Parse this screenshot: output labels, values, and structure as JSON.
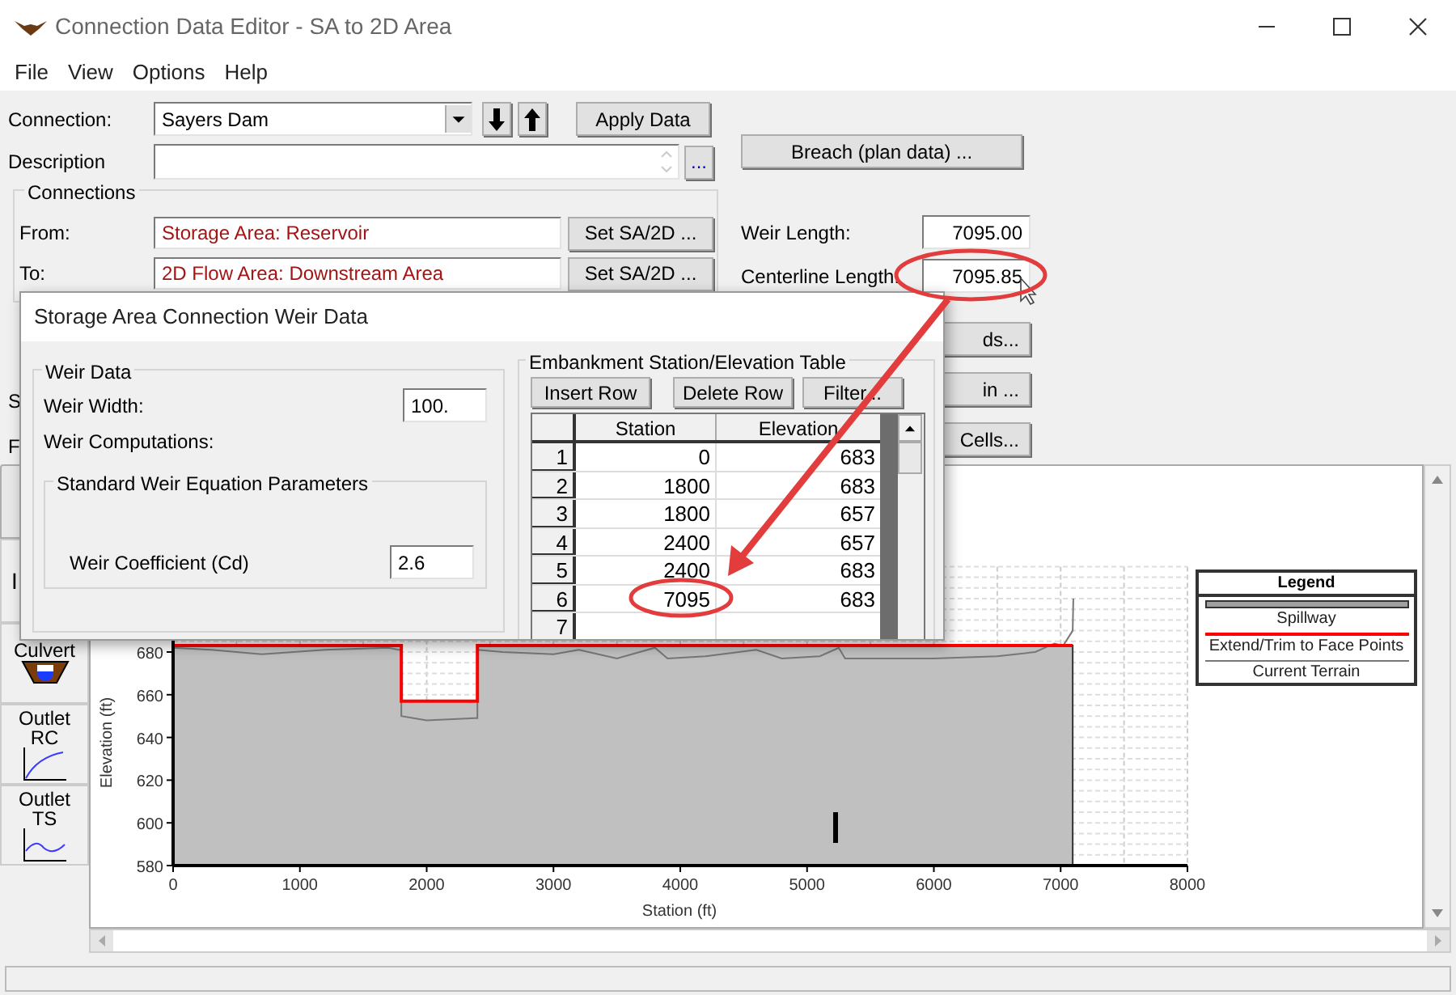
{
  "window": {
    "title": "Connection Data Editor - SA to 2D Area"
  },
  "menu": [
    "File",
    "View",
    "Options",
    "Help"
  ],
  "connection": {
    "label": "Connection:",
    "value": "Sayers Dam",
    "apply": "Apply Data"
  },
  "description": {
    "label": "Description",
    "more": "..."
  },
  "breach_button": "Breach (plan data) ...",
  "connections": {
    "title": "Connections",
    "from": {
      "label": "From:",
      "value": "Storage Area: Reservoir",
      "button": "Set SA/2D ..."
    },
    "to": {
      "label": "To:",
      "value": "2D Flow Area: Downstream Area",
      "button": "Set SA/2D ..."
    }
  },
  "weir_length": {
    "label": "Weir Length:",
    "value": "7095.00"
  },
  "centerline_length": {
    "label": "Centerline Length:",
    "value": "7095.85"
  },
  "partial_buttons": [
    "ds...",
    "in ...",
    "Cells..."
  ],
  "partial_labels": [
    "S",
    "F",
    "I"
  ],
  "toolbar": [
    {
      "kind": "culvert",
      "lines": [
        "Culvert"
      ]
    },
    {
      "kind": "rating_curve",
      "lines": [
        "Outlet",
        "RC"
      ]
    },
    {
      "kind": "time_series",
      "lines": [
        "Outlet",
        "TS"
      ]
    }
  ],
  "dialog": {
    "title": "Storage Area Connection Weir Data",
    "weir_data": {
      "title": "Weir Data",
      "width_label": "Weir Width:",
      "width_value": "100.",
      "computations_label": "Weir Computations:",
      "equation_group": "Standard Weir Equation Parameters",
      "coefficient_label": "Weir Coefficient (Cd)",
      "coefficient_value": "2.6"
    },
    "table": {
      "title": "Embankment Station/Elevation Table",
      "buttons": [
        "Insert Row",
        "Delete Row",
        "Filter..."
      ],
      "columns": [
        "Station",
        "Elevation"
      ],
      "rows": [
        {
          "index": "1",
          "station": "0",
          "elevation": "683"
        },
        {
          "index": "2",
          "station": "1800",
          "elevation": "683"
        },
        {
          "index": "3",
          "station": "1800",
          "elevation": "657"
        },
        {
          "index": "4",
          "station": "2400",
          "elevation": "657"
        },
        {
          "index": "5",
          "station": "2400",
          "elevation": "683"
        },
        {
          "index": "6",
          "station": "7095",
          "elevation": "683"
        },
        {
          "index": "7"
        }
      ]
    }
  },
  "plot": {
    "chart_data": {
      "type": "line",
      "grid": true,
      "xlabel": "Station (ft)",
      "ylabel": "Elevation (ft)",
      "x": [
        0,
        300,
        700,
        1200,
        1700,
        1780,
        1800,
        1800,
        2000,
        2380,
        2400,
        2400,
        2600,
        3000,
        3200,
        3500,
        3800,
        3900,
        4200,
        4600,
        4800,
        5100,
        5250,
        5300,
        6000,
        6500,
        6800,
        6950,
        7020,
        7095,
        7100
      ],
      "series": [
        {
          "name": "Extend/Trim to Face Points",
          "type": "area",
          "color": "#ff0000",
          "values": [
            683,
            683,
            683,
            683,
            683,
            683,
            683,
            657,
            657,
            657,
            657,
            683,
            683,
            683,
            683,
            683,
            683,
            683,
            683,
            683,
            683,
            683,
            683,
            683,
            683,
            683,
            683,
            683,
            683,
            683,
            null
          ]
        },
        {
          "name": "Current Terrain",
          "type": "line",
          "color": "#777777",
          "values": [
            682,
            681,
            679,
            681,
            682,
            681,
            681,
            650,
            648,
            649,
            649,
            681,
            680,
            679,
            681,
            677,
            682,
            677,
            678,
            681,
            677,
            678,
            682,
            677,
            677,
            678,
            680,
            684,
            683,
            690,
            705
          ]
        }
      ],
      "xlim": [
        0,
        8000
      ],
      "ylim": [
        580,
        720
      ],
      "xticks": [
        0,
        1000,
        2000,
        3000,
        4000,
        5000,
        6000,
        7000,
        8000
      ],
      "yticks": [
        580,
        600,
        620,
        640,
        660,
        680
      ]
    },
    "legend": {
      "title": "Legend",
      "items": [
        {
          "label": "Spillway",
          "kind": "bar",
          "color": "#a0a0a0"
        },
        {
          "kind": "series"
        },
        {
          "kind": "series"
        }
      ]
    }
  }
}
